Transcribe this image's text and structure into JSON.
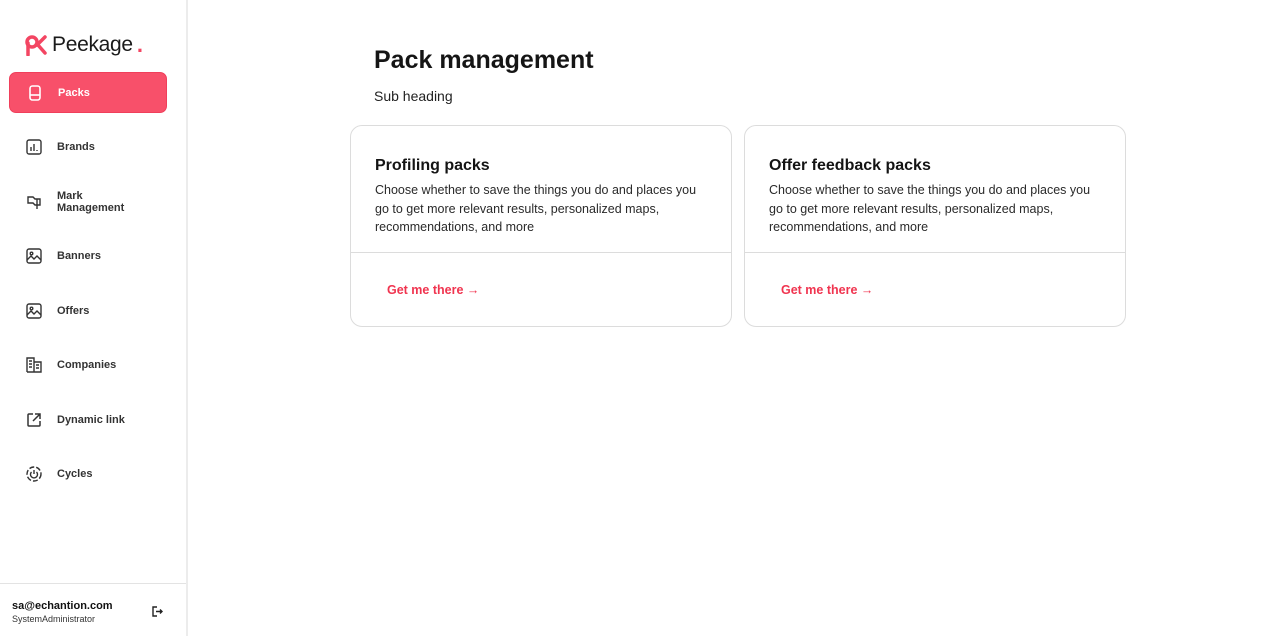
{
  "brand": {
    "name": "Peekage",
    "accent": "#f8506a"
  },
  "sidebar": {
    "items": [
      {
        "label": "Packs",
        "icon": "pack-icon",
        "active": true
      },
      {
        "label": "Brands",
        "icon": "chart-icon"
      },
      {
        "label": "Mark Management",
        "icon": "flag-icon"
      },
      {
        "label": "Banners",
        "icon": "image-icon"
      },
      {
        "label": "Offers",
        "icon": "image-icon"
      },
      {
        "label": "Companies",
        "icon": "building-icon"
      },
      {
        "label": "Dynamic link",
        "icon": "external-link-icon"
      },
      {
        "label": "Cycles",
        "icon": "cycle-icon"
      }
    ]
  },
  "user": {
    "email": "sa@echantion.com",
    "role": "SystemAdministrator"
  },
  "main": {
    "title": "Pack management",
    "subtitle": "Sub heading",
    "cards": [
      {
        "title": "Profiling packs",
        "description": "Choose whether to save the things you do and places you go to get more relevant results, personalized maps, recommendations, and more",
        "link": "Get me there →"
      },
      {
        "title": "Offer feedback packs",
        "description": "Choose whether to save the things you do and places you go to get more relevant results, personalized maps, recommendations, and more",
        "link": "Get me there →"
      }
    ]
  }
}
